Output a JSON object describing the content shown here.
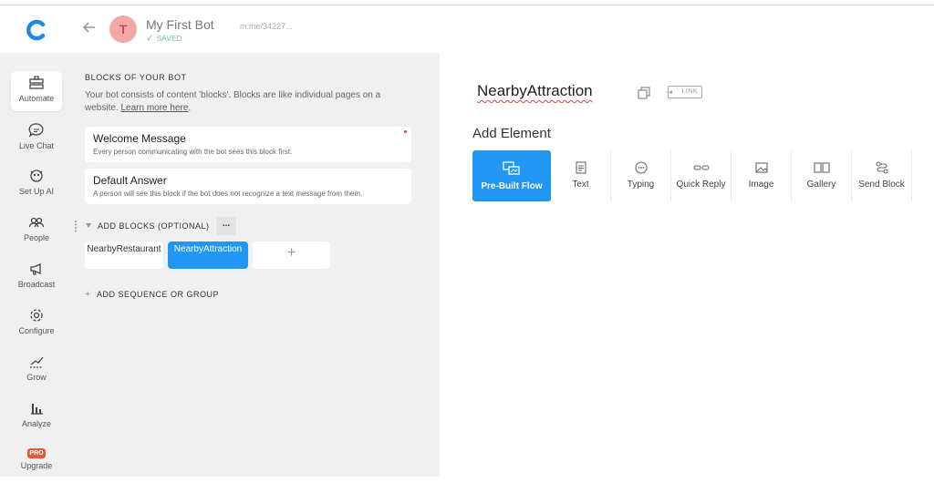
{
  "header": {
    "bot_name": "My First Bot",
    "status": "SAVED",
    "avatar_letter": "T",
    "bot_link": "m.me/34227..."
  },
  "nav": {
    "items": [
      {
        "label": "Automate",
        "icon": "automate-icon"
      },
      {
        "label": "Live Chat",
        "icon": "chat-bubble-icon"
      },
      {
        "label": "Set Up AI",
        "icon": "ai-icon"
      },
      {
        "label": "People",
        "icon": "people-icon"
      },
      {
        "label": "Broadcast",
        "icon": "megaphone-icon"
      },
      {
        "label": "Configure",
        "icon": "gear-icon"
      },
      {
        "label": "Grow",
        "icon": "grow-icon"
      },
      {
        "label": "Analyze",
        "icon": "bar-chart-icon"
      },
      {
        "label": "Upgrade",
        "icon": "pro-badge-icon",
        "badge": "PRO"
      }
    ]
  },
  "blocks": {
    "title": "BLOCKS OF YOUR BOT",
    "description": "Your bot consists of content 'blocks'. Blocks are like individual pages on a website.",
    "learn_more": "Learn more here",
    "welcome": {
      "title": "Welcome Message",
      "desc": "Every person communicating with the bot sees this block first."
    },
    "default": {
      "title": "Default Answer",
      "desc": "A person will see this block if the bot does not recognize a text message from them."
    },
    "add_blocks_label": "ADD BLOCKS (OPTIONAL)",
    "more_label": "...",
    "chips": [
      "NearbyRestaurant",
      "NearbyAttraction"
    ],
    "add_chip": "+",
    "add_sequence": "ADD SEQUENCE OR GROUP"
  },
  "editor": {
    "block_name": "NearbyAttraction",
    "link_badge": "LINK",
    "add_element_title": "Add Element",
    "elements": [
      {
        "label": "Pre-Built Flow",
        "icon": "pre-built-flow-icon"
      },
      {
        "label": "Text",
        "icon": "text-icon"
      },
      {
        "label": "Typing",
        "icon": "typing-icon"
      },
      {
        "label": "Quick Reply",
        "icon": "quick-reply-icon"
      },
      {
        "label": "Image",
        "icon": "image-icon"
      },
      {
        "label": "Gallery",
        "icon": "gallery-icon"
      },
      {
        "label": "Send Block",
        "icon": "send-block-icon"
      }
    ]
  },
  "colors": {
    "accent": "#2196f3",
    "saved": "#6cc08c",
    "avatar_bg": "#f4a7a7",
    "pro": "#e15a3a"
  }
}
